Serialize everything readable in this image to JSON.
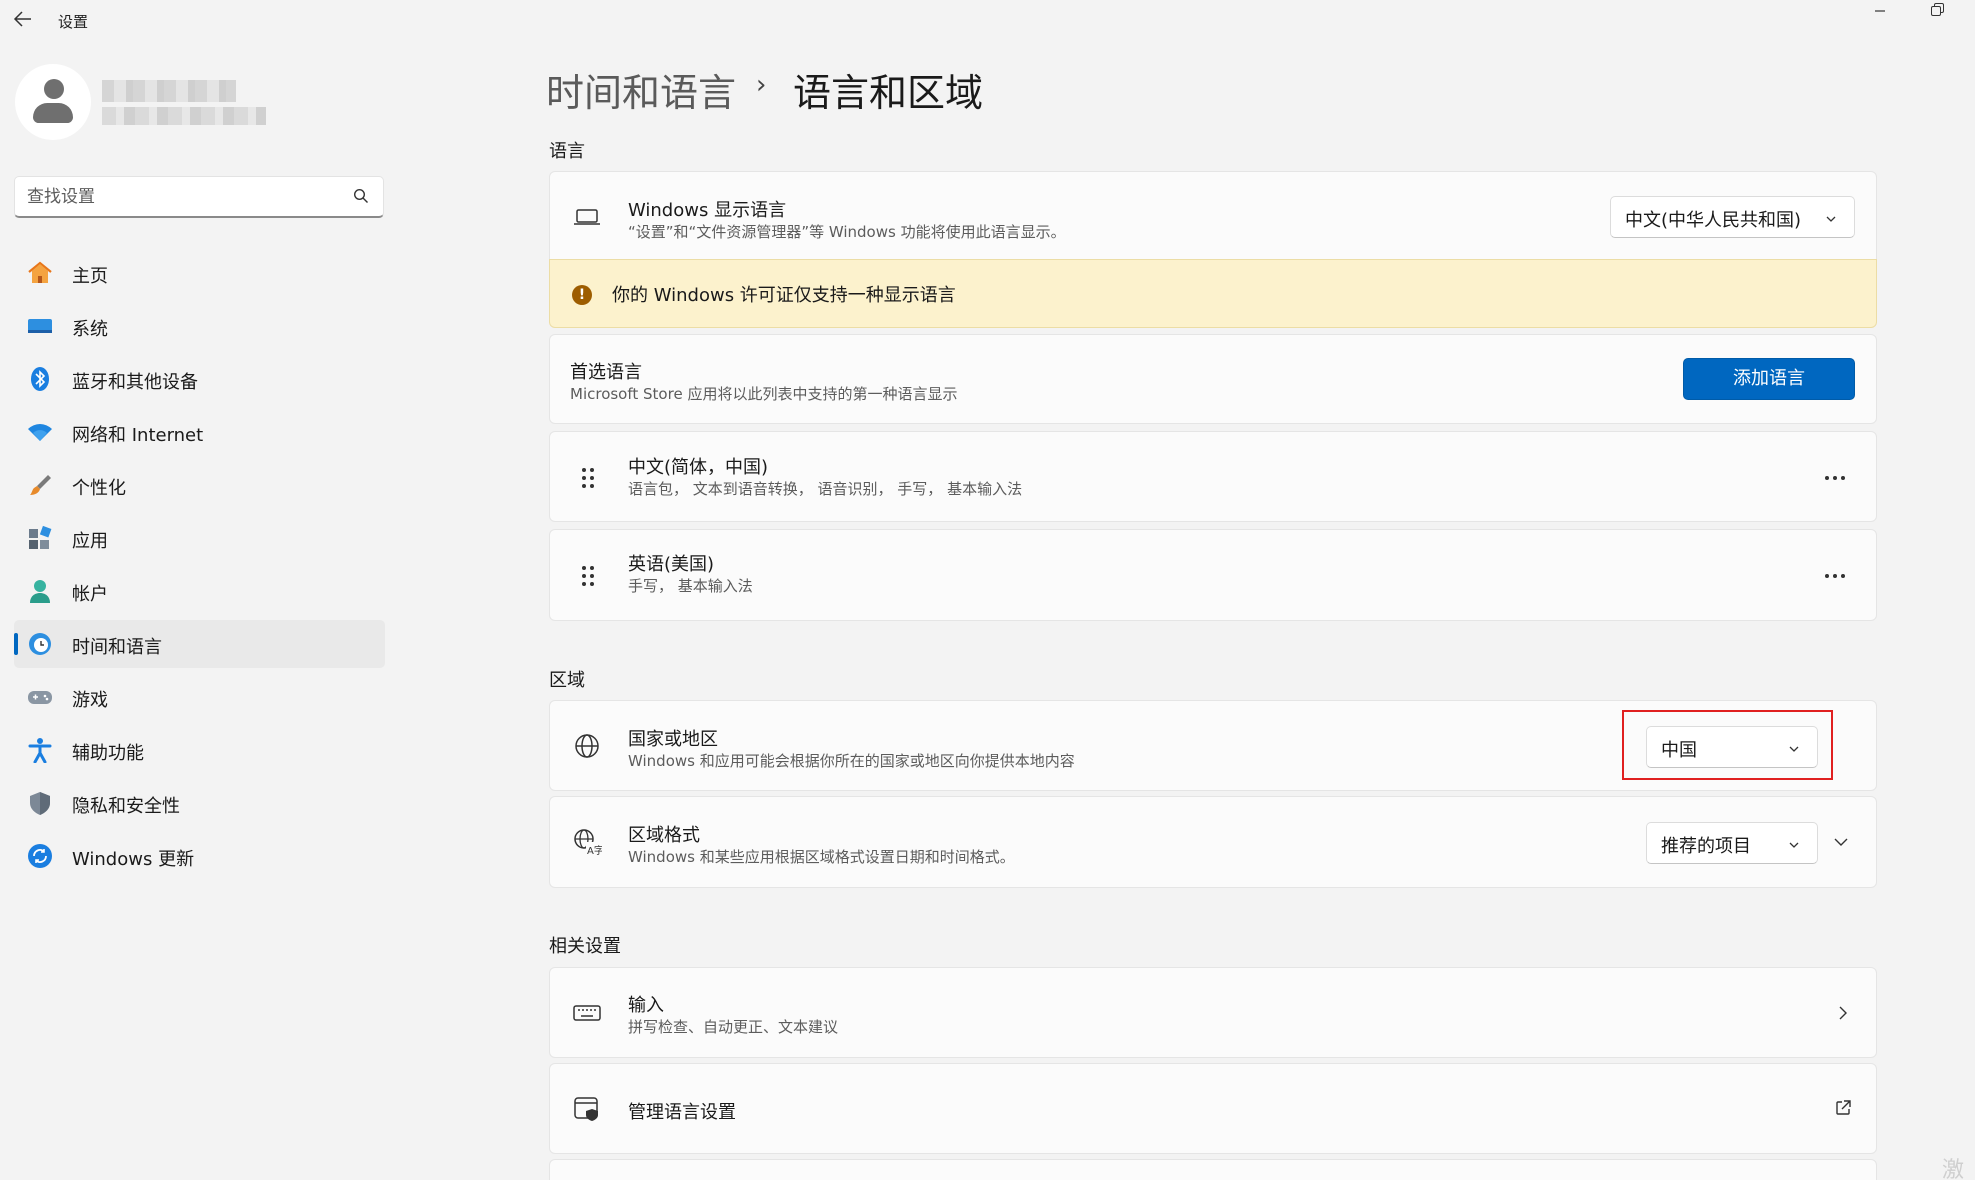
{
  "window": {
    "title": "设置",
    "back_icon": "arrow-left-icon",
    "minimize_icon": "minimize-icon",
    "restore_icon": "restore-icon"
  },
  "sidebar": {
    "search_placeholder": "查找设置",
    "items": [
      {
        "label": "主页",
        "icon": "home-icon"
      },
      {
        "label": "系统",
        "icon": "monitor-icon"
      },
      {
        "label": "蓝牙和其他设备",
        "icon": "bluetooth-icon"
      },
      {
        "label": "网络和 Internet",
        "icon": "wifi-icon"
      },
      {
        "label": "个性化",
        "icon": "brush-icon"
      },
      {
        "label": "应用",
        "icon": "apps-icon"
      },
      {
        "label": "帐户",
        "icon": "person-icon"
      },
      {
        "label": "时间和语言",
        "icon": "clock-globe-icon"
      },
      {
        "label": "游戏",
        "icon": "gamepad-icon"
      },
      {
        "label": "辅助功能",
        "icon": "accessibility-icon"
      },
      {
        "label": "隐私和安全性",
        "icon": "shield-icon"
      },
      {
        "label": "Windows 更新",
        "icon": "update-icon"
      }
    ],
    "active_item": "时间和语言"
  },
  "breadcrumb": {
    "parent": "时间和语言",
    "separator": "›",
    "current": "语言和区域"
  },
  "language_section": {
    "title": "语言",
    "display_language": {
      "title": "Windows 显示语言",
      "subtitle": "“设置”和“文件资源管理器”等 Windows 功能将使用此语言显示。",
      "value": "中文(中华人民共和国)"
    },
    "warning": "你的 Windows 许可证仅支持一种显示语言",
    "preferred": {
      "title": "首选语言",
      "subtitle": "Microsoft Store 应用将以此列表中支持的第一种语言显示",
      "button": "添加语言"
    },
    "languages": [
      {
        "name": "中文(简体，中国)",
        "features": "语言包， 文本到语音转换， 语音识别， 手写， 基本输入法"
      },
      {
        "name": "英语(美国)",
        "features": "手写， 基本输入法"
      }
    ]
  },
  "region_section": {
    "title": "区域",
    "country": {
      "title": "国家或地区",
      "subtitle": "Windows 和应用可能会根据你所在的国家或地区向你提供本地内容",
      "value": "中国"
    },
    "format": {
      "title": "区域格式",
      "subtitle": "Windows 和某些应用根据区域格式设置日期和时间格式。",
      "value": "推荐的项目"
    }
  },
  "related_section": {
    "title": "相关设置",
    "items": [
      {
        "title": "输入",
        "subtitle": "拼写检查、自动更正、文本建议"
      },
      {
        "title": "管理语言设置",
        "subtitle": ""
      }
    ]
  },
  "colors": {
    "accent": "#0067c0",
    "warning_bg": "#fcf2cd",
    "highlight": "#e02020"
  },
  "watermark": "激"
}
